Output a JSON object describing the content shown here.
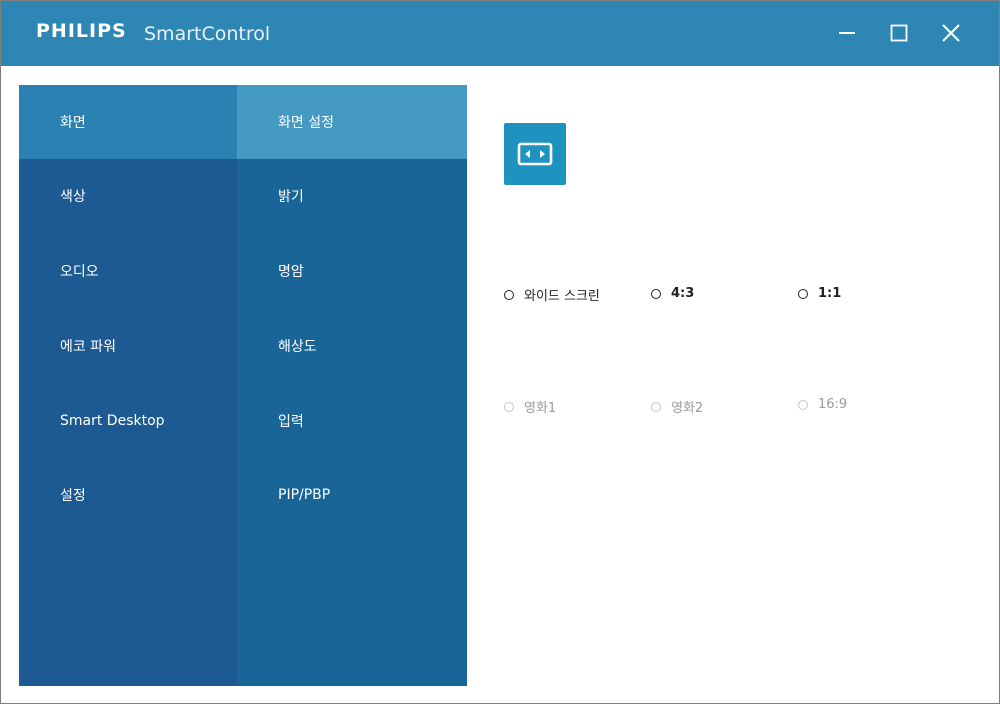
{
  "titlebar": {
    "brand": "PHILIPS",
    "app_name": "SmartControl",
    "background": "#2d86b4",
    "buttons": [
      "minimize-icon",
      "maximize-icon",
      "close-icon"
    ]
  },
  "main_menu": {
    "items": [
      {
        "label": "화면",
        "active": true
      },
      {
        "label": "색상"
      },
      {
        "label": "오디오"
      },
      {
        "label": "에코 파워"
      },
      {
        "label": "Smart Desktop"
      },
      {
        "label": "설정"
      }
    ]
  },
  "sub_menu": {
    "items": [
      {
        "label": "화면 설정",
        "active": true
      },
      {
        "label": "밝기"
      },
      {
        "label": "명암"
      },
      {
        "label": "해상도"
      },
      {
        "label": "입력"
      },
      {
        "label": "PIP/PBP"
      }
    ]
  },
  "content": {
    "mode_icon": "aspect-ratio-icon",
    "options_row1": [
      {
        "label": "와이드 스크린",
        "enabled": true
      },
      {
        "label": "4:3",
        "enabled": true
      },
      {
        "label": "1:1",
        "enabled": true
      }
    ],
    "options_row2": [
      {
        "label": "영화1",
        "enabled": false
      },
      {
        "label": "영화2",
        "enabled": false
      },
      {
        "label": "16:9",
        "enabled": false
      }
    ]
  },
  "colors": {
    "main_menu_bg": "#1d5a91",
    "main_menu_active": "#2a80b0",
    "sub_menu_bg": "#196598",
    "sub_menu_active": "#449ac3",
    "accent_icon": "#1f93c0"
  }
}
